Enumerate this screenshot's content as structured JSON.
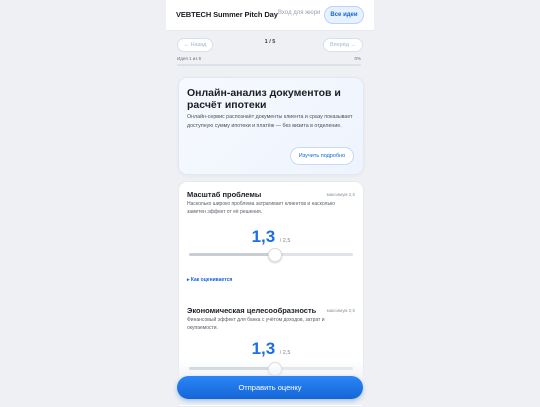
{
  "header": {
    "app_title": "VEBTECH Summer Pitch Day",
    "login_label": "Вход для жюри",
    "all_ideas_label": "Все идеи"
  },
  "navigation": {
    "prev_label": "← Назад",
    "next_label": "Вперёд →",
    "page_indicator": "1 / 5",
    "progress_text": "Идея 1 из 5",
    "progress_percent_label": "0%",
    "progress_value": 0
  },
  "idea": {
    "title": "Онлайн-анализ документов и расчёт ипотеки",
    "description": "Онлайн-сервис распознаёт документы клиента и сразу показывает доступную сумму ипотеки и платёж — без визита в отделение.",
    "details_label": "Изучить подробно"
  },
  "criteria": [
    {
      "title": "Масштаб проблемы",
      "max_label": "максимум 2,5",
      "description": "Насколько широко проблема затрагивает клиентов и насколько заметен эффект от её решения.",
      "score_label": "1,3",
      "score_max_label": "/ 2,5",
      "score": 1.3,
      "max": 2.5,
      "how_label": "▸ Как оценивается"
    },
    {
      "title": "Экономическая целесообразность",
      "max_label": "максимум 2,5",
      "description": "Финансовый эффект для банка с учётом доходов, затрат и окупаемости.",
      "score_label": "1,3",
      "score_max_label": "/ 2,5",
      "score": 1.3,
      "max": 2.5
    }
  ],
  "footer": {
    "submit_label": "Отправить оценку"
  },
  "colors": {
    "accent": "#1466d8",
    "score": "#1e6fe0"
  }
}
